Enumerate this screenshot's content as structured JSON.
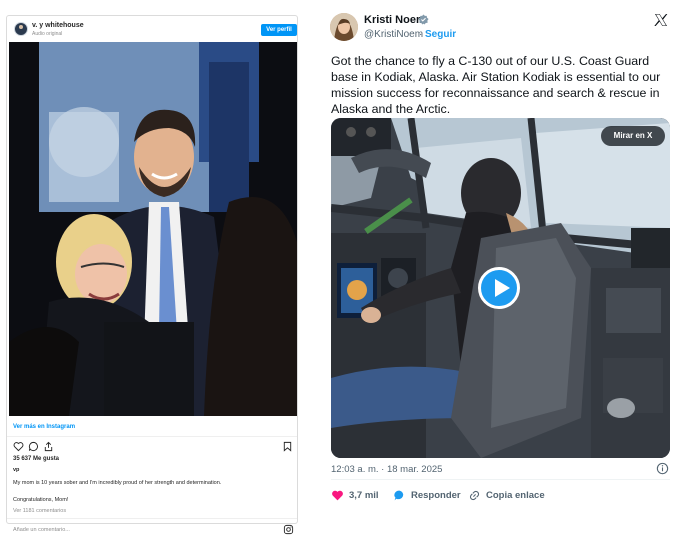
{
  "instagram": {
    "username": "v. y whitehouse",
    "audio": "Audio original",
    "follow_label": "Ver perfil",
    "view_more": "Ver más en Instagram",
    "likes": "35 637 Me gusta",
    "caption_handle": "vp",
    "caption_line1": "My mom is 10 years sober and I'm incredibly proud of her strength and determination.",
    "caption_line2": "Congratulations, Mom!",
    "comments": "Ver 1181 comentarios",
    "add_comment_placeholder": "Añade un comentario..."
  },
  "tweet": {
    "name": "Kristi Noem",
    "handle": "@KristiNoem",
    "separator": "·",
    "follow_label": "Seguir",
    "text": "Got the chance to fly a C-130 out of our U.S. Coast Guard base in Kodiak, Alaska. Air Station Kodiak is essential to our mission success for reconnaissance and search & rescue in Alaska and the Arctic.",
    "watch_label": "Mirar en X",
    "timestamp": "12:03 a. m. · 18 mar. 2025",
    "likes": "3,7 mil",
    "reply_label": "Responder",
    "copy_label": "Copia enlace",
    "like_color": "#f91880",
    "accent": "#1d9bf0"
  }
}
